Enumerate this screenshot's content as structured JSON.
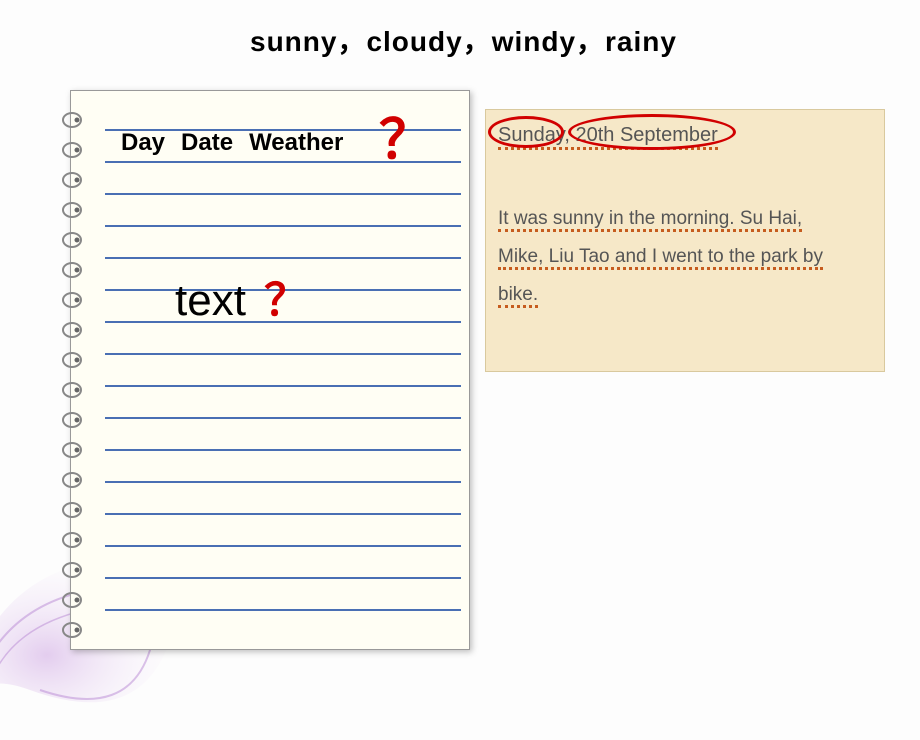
{
  "top_words": "sunny，cloudy，windy，rainy",
  "notebook": {
    "headers": {
      "day": "Day",
      "date": "Date",
      "weather": "Weather"
    },
    "header_question": "？",
    "body_label": "text",
    "body_question": "？"
  },
  "sticky": {
    "dateline": "Sunday, 20th September",
    "body_line1": "It was sunny in the morning. Su Hai,",
    "body_line2": "Mike, Liu Tao and I went to the park by",
    "body_line3": "bike."
  }
}
